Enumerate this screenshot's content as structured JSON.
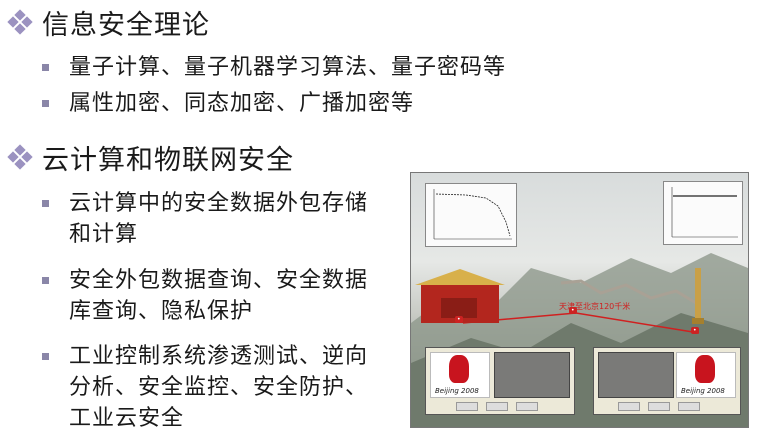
{
  "sections": [
    {
      "title": "信息安全理论",
      "items": [
        "量子计算、量子机器学习算法、量子密码等",
        "属性加密、同态加密、广播加密等"
      ]
    },
    {
      "title": "云计算和物联网安全",
      "items": [
        "云计算中的安全数据外包存储和计算",
        "安全外包数据查询、安全数据库查询、隐私保护",
        "工业控制系统渗透测试、逆向分析、安全监控、安全防护、工业云安全"
      ]
    }
  ],
  "figure": {
    "route_label": "天津至北京120千米",
    "left_window_logo": "Beijing 2008",
    "right_window_logo": "Beijing 2008"
  },
  "colors": {
    "bullet_diamond": "#9b92c0",
    "bullet_square": "#8a86a8",
    "route_line": "#d02020"
  }
}
